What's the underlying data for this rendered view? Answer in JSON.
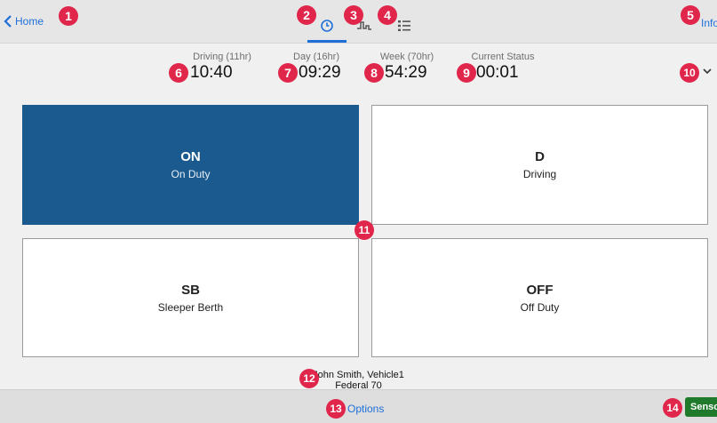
{
  "header": {
    "back_label": "Home",
    "info_label": "Info",
    "tabs": [
      {
        "icon": "clock-icon",
        "active": true
      },
      {
        "icon": "graph-icon",
        "active": false
      },
      {
        "icon": "list-icon",
        "active": false
      }
    ]
  },
  "stats": [
    {
      "label": "Driving (11hr)",
      "value": "10:40"
    },
    {
      "label": "Day (16hr)",
      "value": "09:29"
    },
    {
      "label": "Week (70hr)",
      "value": "54:29"
    },
    {
      "label": "Current Status",
      "value": "00:01"
    }
  ],
  "statuses": [
    {
      "code": "ON",
      "desc": "On Duty",
      "active": true
    },
    {
      "code": "D",
      "desc": "Driving",
      "active": false
    },
    {
      "code": "SB",
      "desc": "Sleeper Berth",
      "active": false
    },
    {
      "code": "OFF",
      "desc": "Off Duty",
      "active": false
    }
  ],
  "footer": {
    "driver_vehicle": "John Smith, Vehicle1",
    "ruleset": "Federal 70",
    "options_label": "Options",
    "sensor_label": "Sensor"
  },
  "badges": [
    "1",
    "2",
    "3",
    "4",
    "5",
    "6",
    "7",
    "8",
    "9",
    "10",
    "11",
    "12",
    "13",
    "14"
  ],
  "colors": {
    "accent": "#1e6fd9",
    "active_tile": "#1b5a8f",
    "badge": "#e0264a",
    "sensor": "#1f7a2b"
  }
}
